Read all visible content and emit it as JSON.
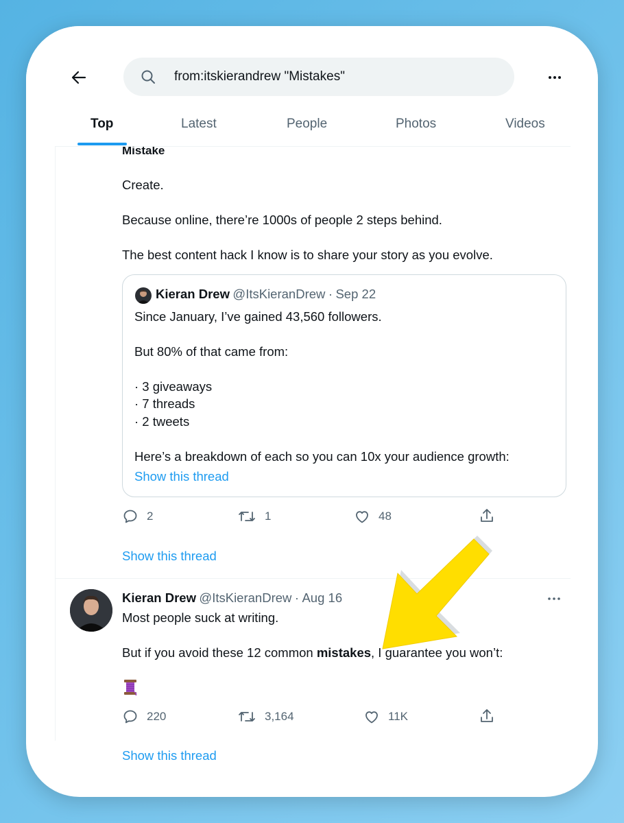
{
  "search": {
    "query": "from:itskierandrew \"Mistakes\""
  },
  "tabs": [
    {
      "label": "Top",
      "active": true
    },
    {
      "label": "Latest",
      "active": false
    },
    {
      "label": "People",
      "active": false
    },
    {
      "label": "Photos",
      "active": false
    },
    {
      "label": "Videos",
      "active": false
    }
  ],
  "tweet1": {
    "cut_heading": "Mistake",
    "paragraphs": [
      "Create.",
      "Because online, there’re 1000s of people 2 steps behind.",
      "The best content hack I know is to share your story as you evolve."
    ],
    "quote": {
      "name": "Kieran Drew",
      "handle": "@ItsKieranDrew",
      "date": "Sep 22",
      "line1": "Since January, I’ve gained 43,560 followers.",
      "line2": "But 80% of that came from:",
      "bullets": [
        "· 3 giveaways",
        "· 7 threads",
        "· 2 tweets"
      ],
      "line3": "Here’s a breakdown of each so you can 10x your audience growth:",
      "show_thread": "Show this thread"
    },
    "actions": {
      "replies": "2",
      "retweets": "1",
      "likes": "48"
    },
    "show_thread": "Show this thread"
  },
  "tweet2": {
    "name": "Kieran Drew",
    "handle": "@ItsKieranDrew",
    "date": "Aug 16",
    "line1": "Most people suck at writing.",
    "line2_before": "But if you avoid these 12 common ",
    "line2_bold": "mistakes",
    "line2_after": ", I guarantee you won’t:",
    "emoji": "🧵",
    "actions": {
      "replies": "220",
      "retweets": "3,164",
      "likes": "11K"
    },
    "show_thread": "Show this thread"
  },
  "colors": {
    "accent": "#1d9bf0",
    "annotation_arrow": "#ffde00"
  },
  "icons": [
    "back-arrow-icon",
    "search-icon",
    "more-icon",
    "reply-icon",
    "retweet-icon",
    "like-icon",
    "share-icon",
    "thread-spool-icon"
  ]
}
